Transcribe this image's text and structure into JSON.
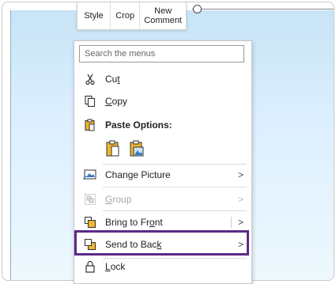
{
  "mini_toolbar": {
    "style_label": "Style",
    "crop_label": "Crop",
    "comment_label_line1": "New",
    "comment_label_line2": "Comment"
  },
  "menu": {
    "search_placeholder": "Search the menus",
    "items": [
      {
        "label_pre": "Cu",
        "label_u": "t",
        "label_post": "",
        "icon": "scissors-icon",
        "enabled": true
      },
      {
        "label_pre": "",
        "label_u": "C",
        "label_post": "opy",
        "icon": "copy-icon",
        "enabled": true
      },
      {
        "label": "Paste Options:",
        "icon": "paste-icon",
        "enabled": true
      },
      {
        "label_pre": "Chan",
        "label_u": "g",
        "label_post": "e Picture",
        "icon": "change-picture-icon",
        "enabled": true,
        "submenu": true
      },
      {
        "label_pre": "",
        "label_u": "G",
        "label_post": "roup",
        "icon": "group-icon",
        "enabled": false,
        "submenu": true
      },
      {
        "label_pre": "Bring to Fr",
        "label_u": "o",
        "label_post": "nt",
        "icon": "bring-to-front-icon",
        "enabled": true,
        "submenu": true
      },
      {
        "label_pre": "Send to Bac",
        "label_u": "k",
        "label_post": "",
        "icon": "send-to-back-icon",
        "enabled": true,
        "submenu": true
      },
      {
        "label_pre": "",
        "label_u": "L",
        "label_post": "ock",
        "icon": "lock-icon",
        "enabled": true
      }
    ],
    "submenu_arrow": ">"
  },
  "colors": {
    "highlight_border": "#5b2a86",
    "icon_yellow": "#f2b52e",
    "icon_blue": "#3a78c2"
  }
}
